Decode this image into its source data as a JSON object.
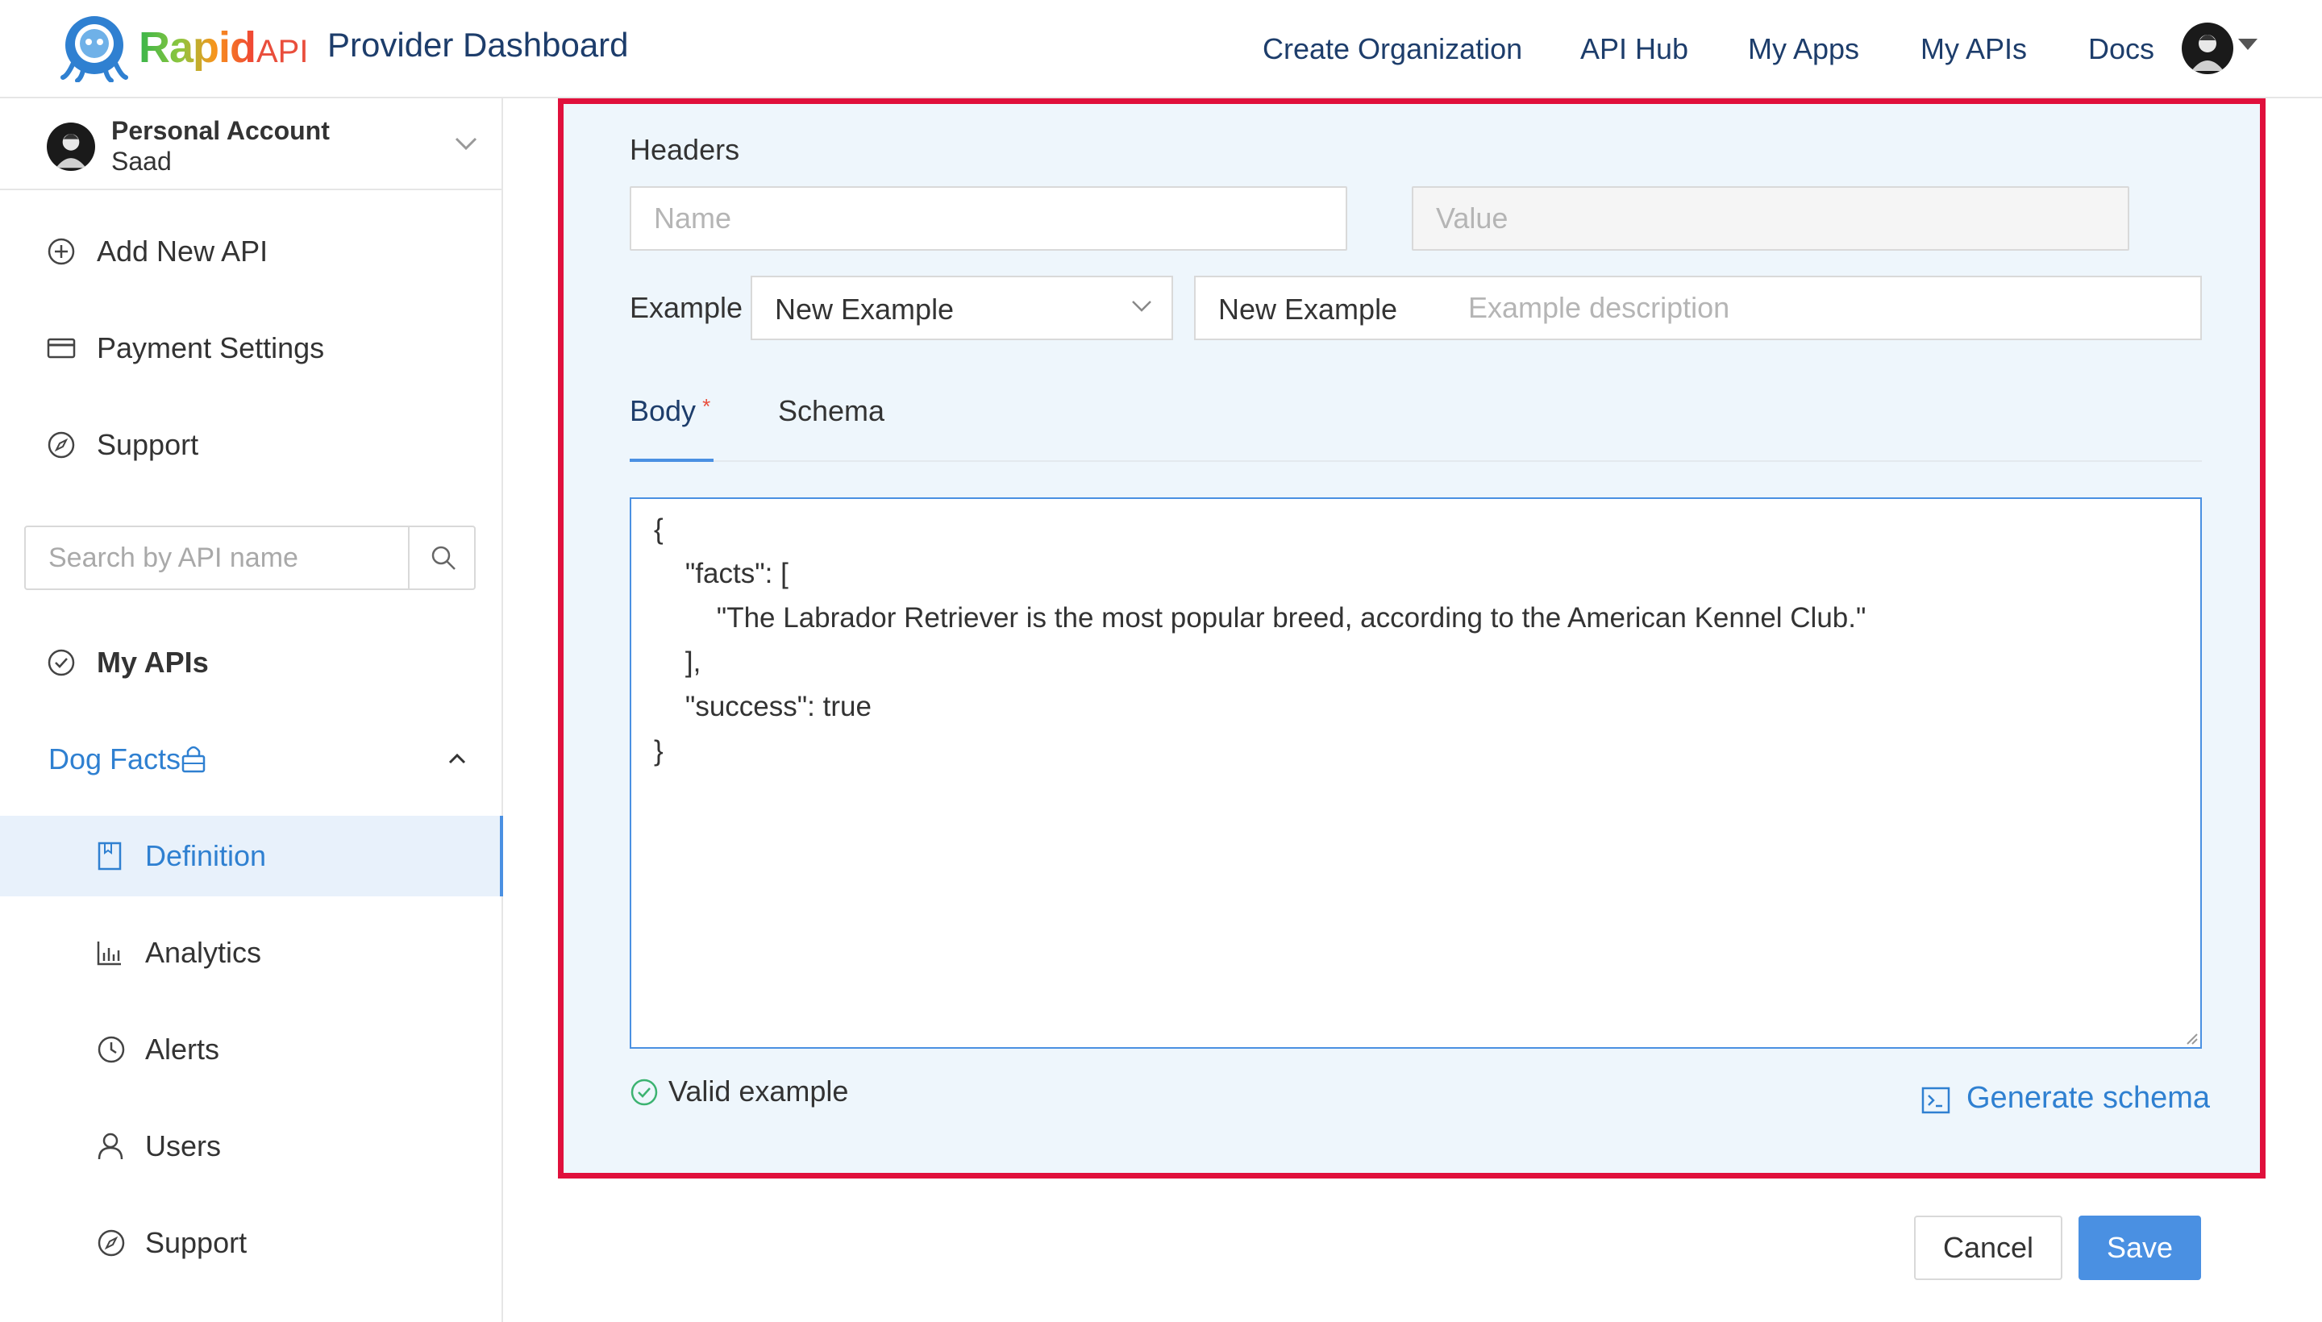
{
  "header": {
    "brand_rapid": "Rapid",
    "brand_api": "API",
    "title": "Provider Dashboard",
    "nav": [
      "Create Organization",
      "API Hub",
      "My Apps",
      "My APIs",
      "Docs"
    ]
  },
  "sidebar": {
    "account": {
      "type": "Personal Account",
      "name": "Saad"
    },
    "items": [
      {
        "label": "Add New API",
        "icon": "plus-circle-icon"
      },
      {
        "label": "Payment Settings",
        "icon": "credit-card-icon"
      },
      {
        "label": "Support",
        "icon": "compass-icon"
      }
    ],
    "search_placeholder": "Search by API name",
    "my_apis_label": "My APIs",
    "api_name": "Dog Facts",
    "sub_items": [
      {
        "label": "Definition",
        "icon": "book-icon",
        "active": true
      },
      {
        "label": "Analytics",
        "icon": "bar-chart-icon"
      },
      {
        "label": "Alerts",
        "icon": "clock-icon"
      },
      {
        "label": "Users",
        "icon": "user-icon"
      },
      {
        "label": "Support",
        "icon": "compass-icon"
      }
    ]
  },
  "main": {
    "headers_label": "Headers",
    "name_placeholder": "Name",
    "value_placeholder": "Value",
    "example_label": "Example",
    "example_select_value": "New Example",
    "example_name_value": "New Example",
    "example_desc_placeholder": "Example description",
    "tabs": [
      {
        "label": "Body",
        "required_mark": "*",
        "active": true
      },
      {
        "label": "Schema"
      }
    ],
    "code_lines": [
      "{",
      "    \"facts\": [",
      "        \"The Labrador Retriever is the most popular breed, according to the American Kennel Club.\"",
      "    ],",
      "    \"success\": true",
      "}"
    ],
    "valid_text": "Valid example",
    "generate_schema_label": "Generate schema",
    "cancel_label": "Cancel",
    "save_label": "Save"
  },
  "colors": {
    "accent": "#4a90e2",
    "highlight_border": "#e0103c",
    "nav_text": "#1d3d6b",
    "valid_green": "#3cb371"
  }
}
